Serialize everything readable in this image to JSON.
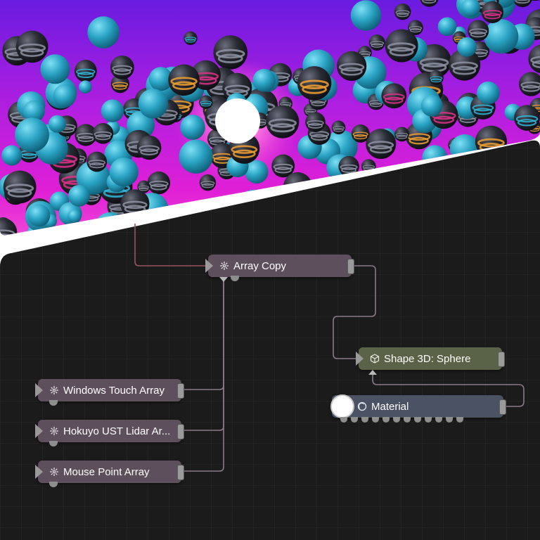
{
  "nodes": {
    "array_copy": {
      "label": "Array Copy",
      "icon": "array-icon"
    },
    "shape_sphere": {
      "label": "Shape 3D: Sphere",
      "icon": "cube-icon"
    },
    "material": {
      "label": "Material",
      "icon": "material-icon"
    },
    "windows_touch": {
      "label": "Windows Touch Array",
      "icon": "array-icon"
    },
    "hokuyo_lidar": {
      "label": "Hokuyo UST Lidar Ar...",
      "icon": "array-icon"
    },
    "mouse_point": {
      "label": "Mouse Point Array",
      "icon": "array-icon"
    }
  },
  "colors": {
    "canvas": "#1b1b1b",
    "grid": "#2a2a2a",
    "array_node": "#5e4f5c",
    "shape_node": "#5a6348",
    "material_node": "#4a5264",
    "wire": "#8a7a88",
    "wire_red": "#9a5560",
    "sky_top": "#7b1fd6",
    "sky_mid": "#d21ed2",
    "sphere_cyan": "#2aa3c4",
    "sphere_dark": "#24262e",
    "sun": "#ffffff"
  },
  "preview": {
    "description_icon": "render-preview-image"
  }
}
